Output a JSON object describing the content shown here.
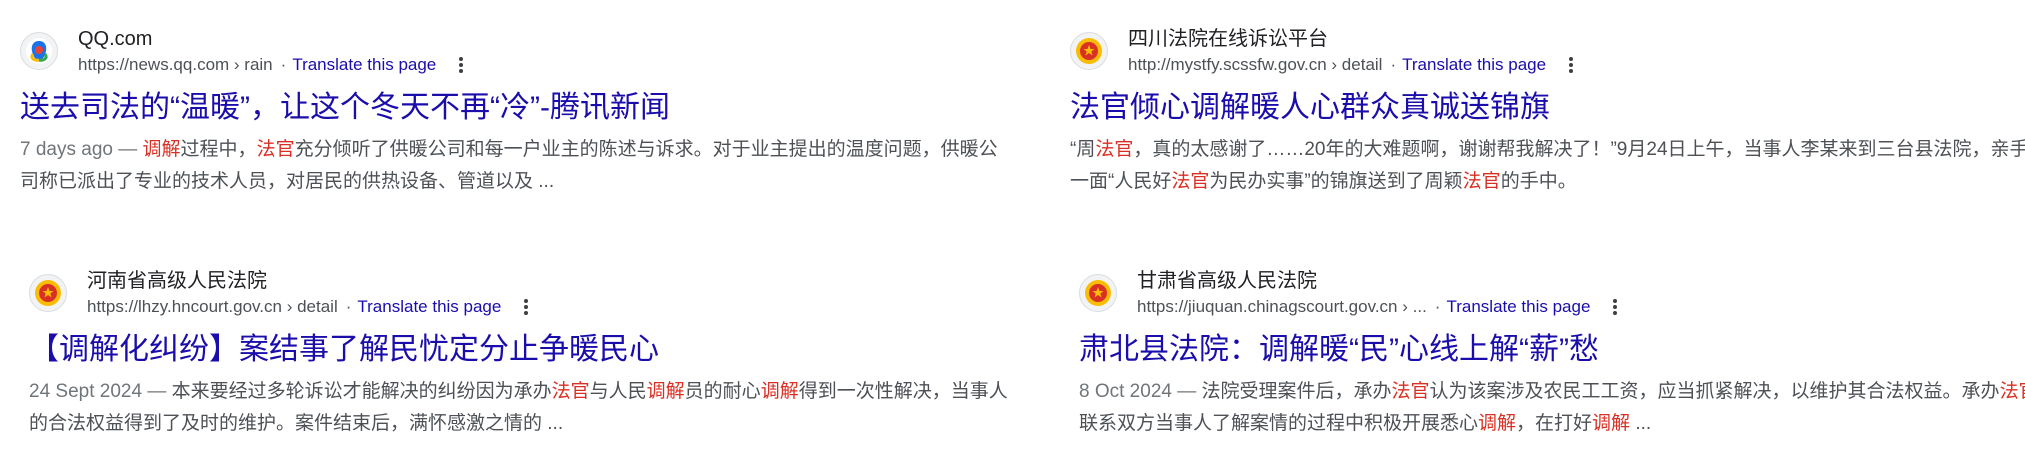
{
  "results": [
    {
      "site_name": "QQ.com",
      "url": "https://news.qq.com › rain",
      "translate": "Translate this page",
      "title": "送去司法的“温暖”，让这个冬天不再“冷”-腾讯新闻",
      "snippet_parts": [
        {
          "text": "7 days ago — ",
          "style": "date"
        },
        {
          "text": "调解",
          "style": "em"
        },
        {
          "text": "过程中，",
          "style": "plain"
        },
        {
          "text": "法官",
          "style": "em"
        },
        {
          "text": "充分倾听了供暖公司和每一户业主的陈述与诉求。对于业主提出的温度问题，供暖公司称已派出了专业的技术人员，对居民的供热设备、管道以及 ...",
          "style": "plain"
        }
      ],
      "favicon": "qq-logo-icon"
    },
    {
      "site_name": "四川法院在线诉讼平台",
      "url": "http://mystfy.scssfw.gov.cn › detail",
      "translate": "Translate this page",
      "title": "法官倾心调解暖人心群众真诚送锦旗",
      "snippet_parts": [
        {
          "text": "“周",
          "style": "plain"
        },
        {
          "text": "法官",
          "style": "em"
        },
        {
          "text": "，真的太感谢了……20年的大难题啊，谢谢帮我解决了！”9月24日上午，当事人李某来到三台县法院，亲手将一面“人民好",
          "style": "plain"
        },
        {
          "text": "法官",
          "style": "em"
        },
        {
          "text": "为民办实事”的锦旗送到了周颖",
          "style": "plain"
        },
        {
          "text": "法官",
          "style": "em"
        },
        {
          "text": "的手中。",
          "style": "plain"
        }
      ],
      "favicon": "court-emblem-icon"
    },
    {
      "site_name": "河南省高级人民法院",
      "url": "https://lhzy.hncourt.gov.cn › detail",
      "translate": "Translate this page",
      "title": "【调解化纠纷】案结事了解民忧定分止争暖民心",
      "snippet_parts": [
        {
          "text": "24 Sept 2024 — ",
          "style": "date"
        },
        {
          "text": "本来要经过多轮诉讼才能解决的纠纷因为承办",
          "style": "plain"
        },
        {
          "text": "法官",
          "style": "em"
        },
        {
          "text": "与人民",
          "style": "plain"
        },
        {
          "text": "调解",
          "style": "em"
        },
        {
          "text": "员的耐心",
          "style": "plain"
        },
        {
          "text": "调解",
          "style": "em"
        },
        {
          "text": "得到一次性解决，当事人的合法权益得到了及时的维护。案件结束后，满怀感激之情的 ...",
          "style": "plain"
        }
      ],
      "favicon": "court-emblem-icon"
    },
    {
      "site_name": "甘肃省高级人民法院",
      "url": "https://jiuquan.chinagscourt.gov.cn › ...",
      "translate": "Translate this page",
      "title": "肃北县法院：调解暖“民”心线上解“薪”愁",
      "snippet_parts": [
        {
          "text": "8 Oct 2024 — ",
          "style": "date"
        },
        {
          "text": "法院受理案件后，承办",
          "style": "plain"
        },
        {
          "text": "法官",
          "style": "em"
        },
        {
          "text": "认为该案涉及农民工工资，应当抓紧解决，以维护其合法权益。承办",
          "style": "plain"
        },
        {
          "text": "法官",
          "style": "em"
        },
        {
          "text": "在联系双方当事人了解案情的过程中积极开展悉心",
          "style": "plain"
        },
        {
          "text": "调解",
          "style": "em"
        },
        {
          "text": "，在打好",
          "style": "plain"
        },
        {
          "text": "调解",
          "style": "em"
        },
        {
          "text": " ...",
          "style": "plain"
        }
      ],
      "favicon": "court-emblem-icon"
    }
  ],
  "colors": {
    "title_link": "#1a0dab",
    "highlight": "#d93025",
    "snippet": "#4d5156"
  }
}
